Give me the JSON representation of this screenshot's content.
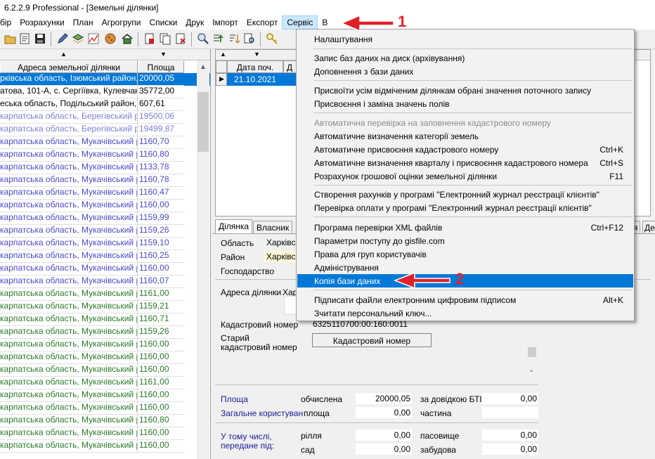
{
  "window": {
    "title": "6.2.2.9 Professional - [Земельні ділянки]"
  },
  "menubar": [
    "бір",
    "Розрахунки",
    "План",
    "Агрогрупи",
    "Списки",
    "Друк",
    "Імпорт",
    "Експорт",
    "Сервіс",
    "В"
  ],
  "left_sort": [
    "▲",
    "▼"
  ],
  "table": {
    "headers": [
      "Адреса земельної ділянки",
      "Площа"
    ],
    "rows": [
      {
        "addr": "рківська область, Ізюмський район, Ба",
        "area": "20000,05",
        "color": "sel"
      },
      {
        "addr": "атова, 101-А, с. Сергіївка, Кулевчанськ",
        "area": "35772,00",
        "color": "#000000"
      },
      {
        "addr": "еська область, Подільський район, с. Г",
        "area": "607,61",
        "color": "#000000"
      },
      {
        "addr": "карпатська область, Берегівський рай",
        "area": "19500,06",
        "color": "#7f7fd8"
      },
      {
        "addr": "карпатська область, Берегівський рай",
        "area": "19499,87",
        "color": "#7f7fd8"
      },
      {
        "addr": "карпатська область, Мукачівський рай",
        "area": "1160,70",
        "color": "#4a4acc"
      },
      {
        "addr": "карпатська область, Мукачівський рай",
        "area": "1160,80",
        "color": "#4a4acc"
      },
      {
        "addr": "карпатська область, Мукачівський рай",
        "area": "1133,78",
        "color": "#4a4acc"
      },
      {
        "addr": "карпатська область, Мукачівський рай",
        "area": "1160,78",
        "color": "#4a4acc"
      },
      {
        "addr": "карпатська область, Мукачівський рай",
        "area": "1160,47",
        "color": "#4a4acc"
      },
      {
        "addr": "карпатська область, Мукачівський рай",
        "area": "1160,00",
        "color": "#4a4acc"
      },
      {
        "addr": "карпатська область, Мукачівський рай",
        "area": "1159,99",
        "color": "#4a4acc"
      },
      {
        "addr": "карпатська область, Мукачівський рай",
        "area": "1159,26",
        "color": "#4a4acc"
      },
      {
        "addr": "карпатська область, Мукачівський рай",
        "area": "1159,10",
        "color": "#4a4acc"
      },
      {
        "addr": "карпатська область, Мукачівський рай",
        "area": "1160,25",
        "color": "#4a4acc"
      },
      {
        "addr": "карпатська область, Мукачівський рай",
        "area": "1160,00",
        "color": "#4a4acc"
      },
      {
        "addr": "карпатська область, Мукачівський рай",
        "area": "1160,07",
        "color": "#4a4acc"
      },
      {
        "addr": "карпатська область, Мукачівський рай",
        "area": "1161,00",
        "color": "#2a7a2a"
      },
      {
        "addr": "карпатська область, Мукачівський рай",
        "area": "1159,21",
        "color": "#2a7a2a"
      },
      {
        "addr": "карпатська область, Мукачівський рай",
        "area": "1160,71",
        "color": "#2a7a2a"
      },
      {
        "addr": "карпатська область, Мукачівський рай",
        "area": "1159,26",
        "color": "#2a7a2a"
      },
      {
        "addr": "карпатська область, Мукачівський рай",
        "area": "1160,00",
        "color": "#2a7a2a"
      },
      {
        "addr": "карпатська область, Мукачівський рай",
        "area": "1160,00",
        "color": "#2a7a2a"
      },
      {
        "addr": "карпатська область, Мукачівський рай",
        "area": "1160,00",
        "color": "#2a7a2a"
      },
      {
        "addr": "карпатська область, Мукачівський рай",
        "area": "1161,00",
        "color": "#2a7a2a"
      },
      {
        "addr": "карпатська область, Мукачівський рай",
        "area": "1160,00",
        "color": "#2a7a2a"
      },
      {
        "addr": "карпатська область, Мукачівський рай",
        "area": "1160,00",
        "color": "#2a7a2a"
      },
      {
        "addr": "карпатська область, Мукачівський рай",
        "area": "1160,80",
        "color": "#2a7a2a"
      },
      {
        "addr": "карпатська область, Мукачівський рай",
        "area": "1160,00",
        "color": "#2a7a2a"
      },
      {
        "addr": "карпатська область, Мукачівський рай",
        "area": "1160,00",
        "color": "#2a7a2a"
      }
    ]
  },
  "right_grid": {
    "headers": [
      "Дата поч.",
      "Д"
    ],
    "row_value": "21.10.2021"
  },
  "tabs": [
    "Ділянка",
    "Власник",
    "я",
    "Де"
  ],
  "form": {
    "oblast_label": "Область",
    "oblast_value": "Харківс",
    "rayon_label": "Район",
    "rayon_value": "Харківс",
    "gosp_label": "Господарство",
    "adresa_label": "Адреса ділянки",
    "adresa_value": "Хар",
    "kad_label": "Кадастровий номер",
    "kad_value": "6325110700:00:160:0011",
    "old_kad_label": "Старий кадастровий номер",
    "kad_button": "Кадастровий номер",
    "ploshcha_label": "Площа",
    "obchyslena_label": "обчислена",
    "obchyslena_value": "20000,05",
    "bti_label": "за довідкою БТІ",
    "bti_value": "0,00",
    "zagalne_label": "Загальне користування",
    "zag_ploshcha_label": "площа",
    "zag_value": "0,00",
    "chastyna_label": "частина",
    "u_tomu_label": "У тому числі, передане під:",
    "rillia_label": "рілля",
    "rillia_value": "0,00",
    "pasovyshche_label": "пасовище",
    "pasovyshche_value": "0,00",
    "sad_label": "сад",
    "sad_value": "0,00",
    "zabudova_label": "забудова",
    "zabudova_value": "0,00"
  },
  "menu": {
    "items": [
      {
        "label": "Налаштування",
        "shortcut": ""
      },
      {
        "label": "Запис баз даних на диск (архівування)",
        "shortcut": ""
      },
      {
        "label": "Доповнення з бази даних",
        "shortcut": ""
      },
      {
        "label": "Присвоїти усім відміченим ділянкам обрані значення поточного запису",
        "shortcut": ""
      },
      {
        "label": "Присвоєння і заміна значень полів",
        "shortcut": ""
      },
      {
        "label": "Автоматична перевірка на заповнення кадастрового номеру",
        "shortcut": ""
      },
      {
        "label": "Автоматичне визначення категорії земель",
        "shortcut": ""
      },
      {
        "label": "Автоматичне присвоєння кадастрового номеру",
        "shortcut": "Ctrl+K"
      },
      {
        "label": "Автоматичне визначення кварталу і присвоєння кадастрового номера",
        "shortcut": "Ctrl+S"
      },
      {
        "label": "Розрахунок грошової оцінки земельної ділянки",
        "shortcut": "F11"
      },
      {
        "label": "Створення рахунків у програмі \"Електронний журнал реєстрації клієнтів\"",
        "shortcut": ""
      },
      {
        "label": "Перевірка оплати у програмі \"Електронний журнал реєстрації клієнтів\"",
        "shortcut": ""
      },
      {
        "label": "Програма перевірки XML файлів",
        "shortcut": "Ctrl+F12"
      },
      {
        "label": "Параметри поступу до gisfile.com",
        "shortcut": ""
      },
      {
        "label": "Права для груп користувачів",
        "shortcut": ""
      },
      {
        "label": "Адміністрування",
        "shortcut": ""
      },
      {
        "label": "Копія бази даних",
        "shortcut": ""
      },
      {
        "label": "Підписати файли електронним цифровим підписом",
        "shortcut": "Alt+K"
      },
      {
        "label": "Зчитати персональний ключ...",
        "shortcut": ""
      }
    ]
  },
  "annotations": {
    "arrow1": "1",
    "arrow2": "2"
  },
  "colors": {
    "selection": "#0078d7",
    "arrow": "#e0212a",
    "menu_active": "#cce8ff"
  }
}
